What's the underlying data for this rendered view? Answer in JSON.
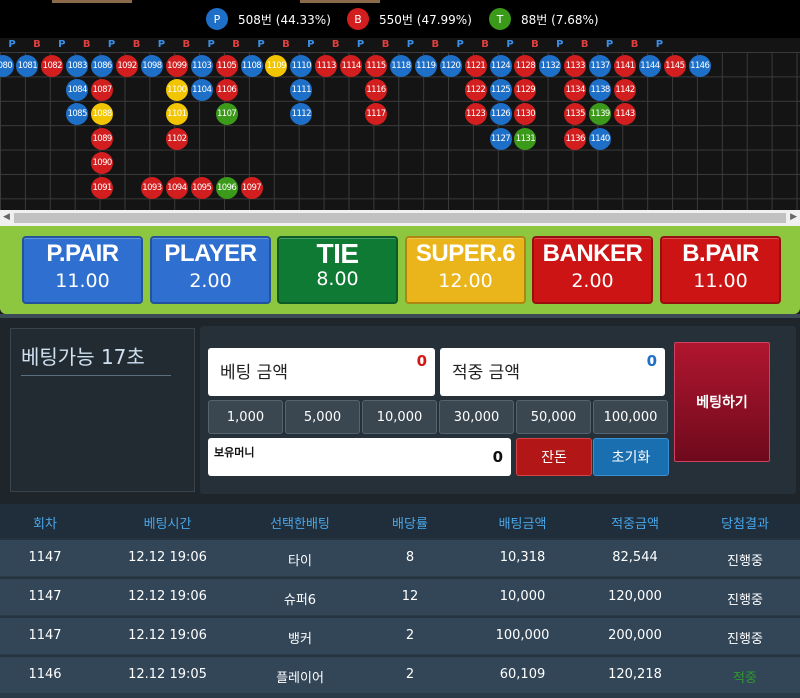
{
  "stats": [
    {
      "letter": "P",
      "text": "508번 (44.33%)",
      "color": "#1e6fc8"
    },
    {
      "letter": "B",
      "text": "550번 (47.99%)",
      "color": "#d21e1e"
    },
    {
      "letter": "T",
      "text": "88번 (7.68%)",
      "color": "#3c9a1a"
    }
  ],
  "road": {
    "header": [
      "P",
      "B",
      "P",
      "B",
      "P",
      "B",
      "P",
      "B",
      "P",
      "B",
      "P",
      "B",
      "P",
      "B",
      "P",
      "B",
      "P",
      "B",
      "P",
      "B",
      "P",
      "B",
      "P",
      "B",
      "P",
      "B",
      "P"
    ],
    "columns": [
      [
        "1080"
      ],
      [
        "1081"
      ],
      [
        "1082"
      ],
      [
        "1083",
        "1084",
        "1085"
      ],
      [
        "1086",
        "1087",
        "1088",
        "1089",
        "1090",
        "1091"
      ],
      [
        "1092"
      ],
      [
        "1098",
        "",
        "",
        "",
        "",
        "1093"
      ],
      [
        "1099",
        "1100",
        "1101",
        "1102",
        "",
        "1094"
      ],
      [
        "1103",
        "1104",
        "",
        "",
        "",
        "1095"
      ],
      [
        "1105",
        "1106",
        "1107",
        "",
        "",
        "1096"
      ],
      [
        "1108",
        "",
        "",
        "",
        "",
        "1097"
      ],
      [
        "1109"
      ],
      [
        "1110",
        "1111",
        "1112"
      ],
      [
        "1113"
      ],
      [
        "1114"
      ],
      [
        "1115",
        "1116",
        "1117"
      ],
      [
        "1118"
      ],
      [
        "1119"
      ],
      [
        "1120"
      ],
      [
        "1121",
        "1122",
        "1123"
      ],
      [
        "1124",
        "1125",
        "1126",
        "1127"
      ],
      [
        "1128",
        "1129",
        "1130",
        "1131"
      ],
      [
        "1132"
      ],
      [
        "1133",
        "1134",
        "1135",
        "1136"
      ],
      [
        "1137",
        "1138",
        "1139",
        "1140"
      ],
      [
        "1141",
        "1142",
        "1143"
      ],
      [
        "1144"
      ],
      [
        "1145"
      ],
      [
        "1146"
      ]
    ],
    "legend_colors": {
      "player": "#1e6fc8",
      "banker": "#d21e1e",
      "tie": "#3c9a1a",
      "super6": "#f2c500"
    }
  },
  "bets": [
    {
      "name": "P.PAIR",
      "odds": "11.00"
    },
    {
      "name": "PLAYER",
      "odds": "2.00"
    },
    {
      "name": "TIE",
      "odds": "8.00"
    },
    {
      "name": "SUPER.6",
      "odds": "12.00"
    },
    {
      "name": "BANKER",
      "odds": "2.00"
    },
    {
      "name": "B.PAIR",
      "odds": "11.00"
    }
  ],
  "panel": {
    "timer": "베팅가능 17초",
    "bet_amount_label": "베팅 금액",
    "bet_amount_value": "0",
    "win_amount_label": "적중 금액",
    "win_amount_value": "0",
    "chips": [
      "1,000",
      "5,000",
      "10,000",
      "30,000",
      "50,000",
      "100,000"
    ],
    "owned_label": "보유머니",
    "owned_value": "0",
    "balance_button": "잔돈",
    "reset_button": "초기화",
    "bet_button": "베팅하기"
  },
  "history": {
    "columns": [
      "회차",
      "베팅시간",
      "선택한배팅",
      "배당률",
      "배팅금액",
      "적중금액",
      "당첨결과"
    ],
    "rows": [
      [
        "1147",
        "12.12 19:06",
        "타이",
        "8",
        "10,318",
        "82,544",
        "진행중"
      ],
      [
        "1147",
        "12.12 19:06",
        "슈퍼6",
        "12",
        "10,000",
        "120,000",
        "진행중"
      ],
      [
        "1147",
        "12.12 19:06",
        "뱅커",
        "2",
        "100,000",
        "200,000",
        "진행중"
      ],
      [
        "1146",
        "12.12 19:05",
        "플레이어",
        "2",
        "60,109",
        "120,218",
        "적중"
      ]
    ]
  }
}
